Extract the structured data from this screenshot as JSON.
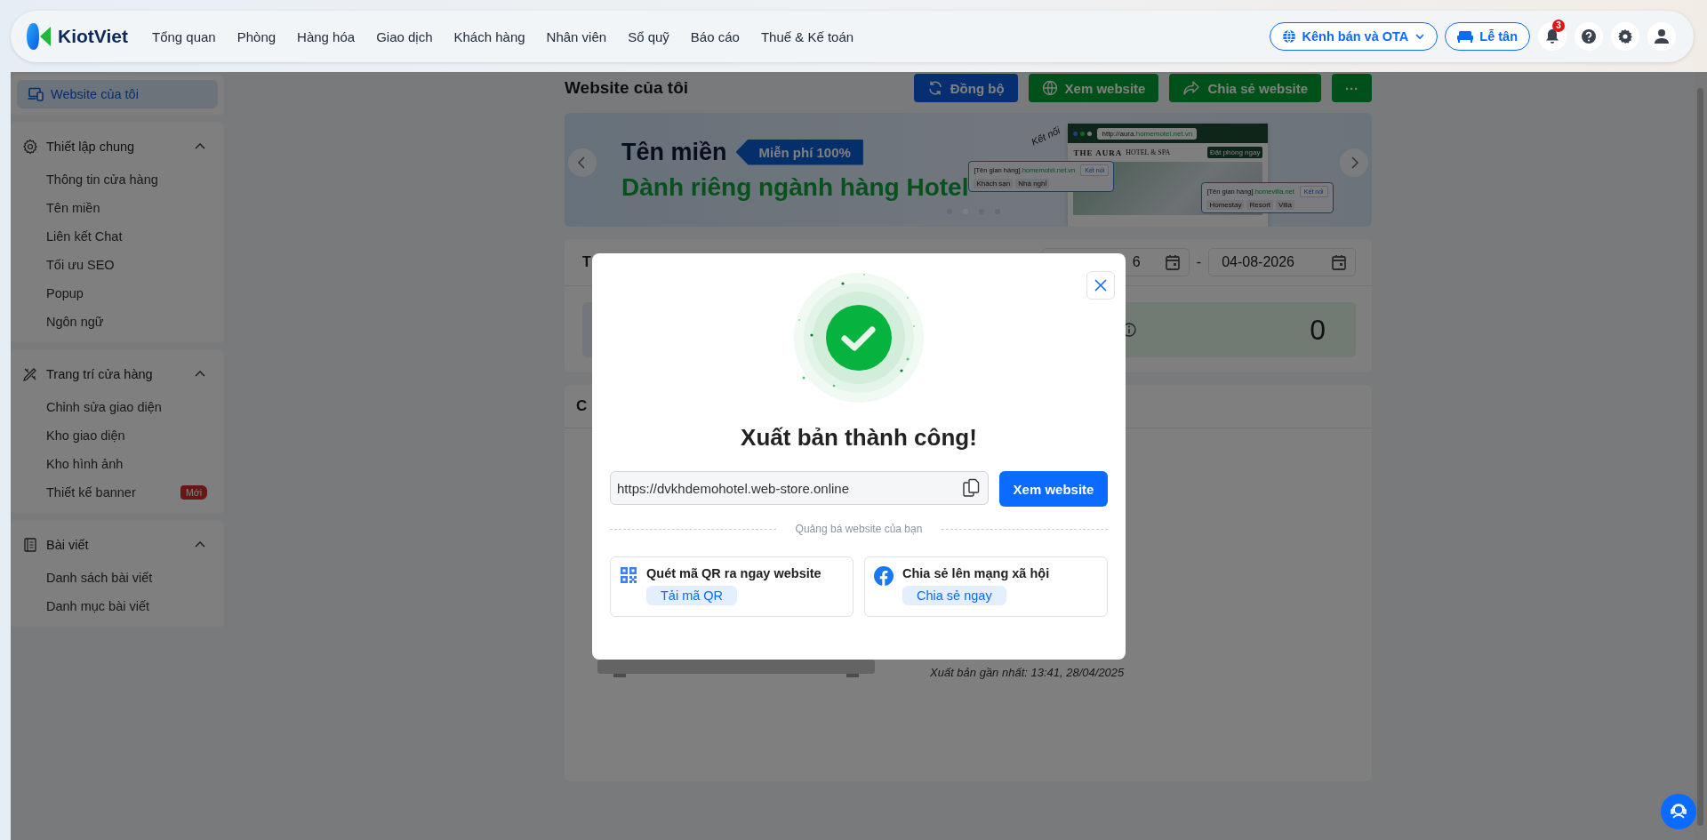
{
  "brand": {
    "name": "KiotViet"
  },
  "nav": [
    "Tổng quan",
    "Phòng",
    "Hàng hóa",
    "Giao dịch",
    "Khách hàng",
    "Nhân viên",
    "Sổ quỹ",
    "Báo cáo",
    "Thuế & Kế toán"
  ],
  "top_actions": {
    "channels": "Kênh bán và OTA",
    "reception": "Lễ tân",
    "notifications": "3"
  },
  "sidebar": {
    "home": {
      "label": "Website của tôi",
      "selected": true
    },
    "sections": [
      {
        "kind": "settings",
        "title": "Thiết lập chung",
        "expanded": true,
        "items": [
          {
            "label": "Thông tin cửa hàng"
          },
          {
            "label": "Tên miền"
          },
          {
            "label": "Liên kết Chat"
          },
          {
            "label": "Tối ưu SEO"
          },
          {
            "label": "Popup"
          },
          {
            "label": "Ngôn ngữ"
          }
        ]
      },
      {
        "kind": "design",
        "title": "Trang trí cửa hàng",
        "expanded": true,
        "items": [
          {
            "label": "Chỉnh sửa giao diện"
          },
          {
            "label": "Kho giao diện"
          },
          {
            "label": "Kho hình ảnh"
          },
          {
            "label": "Thiết kế banner",
            "badge": "Mới"
          }
        ]
      },
      {
        "kind": "article",
        "title": "Bài viết",
        "expanded": true,
        "items": [
          {
            "label": "Danh sách bài viết"
          },
          {
            "label": "Danh mục bài viết"
          }
        ]
      }
    ]
  },
  "page": {
    "title": "Website của tôi",
    "actions": [
      {
        "kind": "sync",
        "label": "Đồng bộ"
      },
      {
        "kind": "globe",
        "label": "Xem website"
      },
      {
        "kind": "share",
        "label": "Chia sẻ website"
      },
      {
        "kind": "more",
        "label": "···"
      }
    ]
  },
  "banner": {
    "title": "Tên miền",
    "tag": "Miễn phí 100%",
    "subtitle": "Dành riêng ngành hàng Hotel",
    "handwriting": "Kết nối",
    "browser": {
      "url_prefix": "http://aura.",
      "url_domain": "homemotel.net.vn",
      "hotel": "THE AURA",
      "hotel_sub": "HOTEL & SPA",
      "book": "Đặt phòng ngay"
    },
    "cards": [
      {
        "name": "[Tên gian hàng]",
        "suffix": ".homemotel.net.vn",
        "tags": [
          "Khách sạn",
          "Nhà nghỉ"
        ],
        "action": "Kết nối"
      },
      {
        "name": "[Tên gian hàng]",
        "suffix": ".homevilla.net",
        "tags": [
          "Homestay",
          "Resort",
          "Villa"
        ],
        "action": "Kết nối"
      }
    ],
    "dots": [
      {
        "selected": false
      },
      {
        "selected": true
      },
      {
        "selected": false
      },
      {
        "selected": false
      }
    ]
  },
  "stats": {
    "label": "T",
    "date_from": "6",
    "separator": "-",
    "date_to": "04-08-2026",
    "value": "0"
  },
  "preview": {
    "heading": "C",
    "last_published": "Xuất bản gần nhất: 13:41, 28/04/2025"
  },
  "modal": {
    "title": "Xuất bản thành công!",
    "url": "https://dvkhdemohotel.web-store.online",
    "view_button": "Xem website",
    "divider": "Quảng bá website của bạn",
    "options": [
      {
        "kind": "qr",
        "title": "Quét mã QR ra ngay website",
        "action": "Tải mã QR"
      },
      {
        "kind": "facebook",
        "title": "Chia sẻ lên mạng xã hội",
        "action": "Chia sẻ ngay"
      }
    ]
  }
}
